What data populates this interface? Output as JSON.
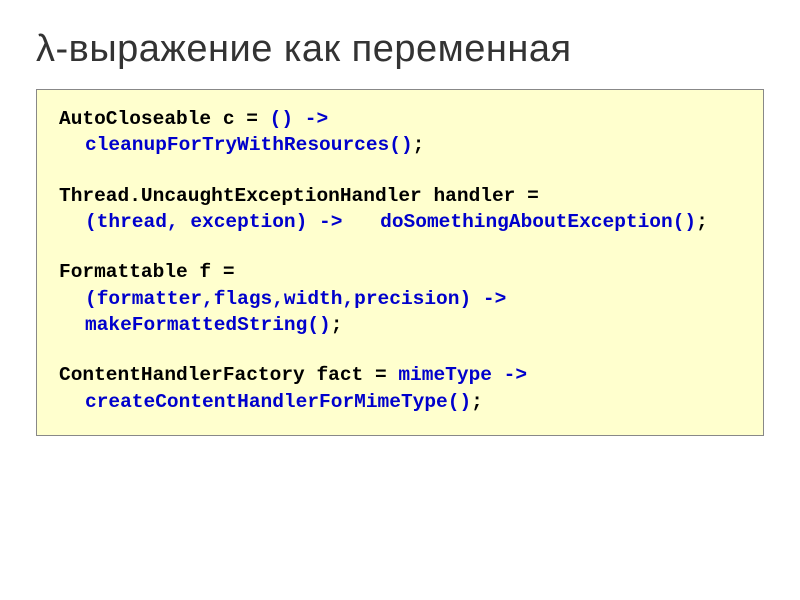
{
  "title": "λ-выражение как переменная",
  "code": {
    "s1": {
      "l1a": "AutoCloseable c = ",
      "l1b": "() ->",
      "l2a": "cleanupForTryWithResources()",
      "l2b": ";"
    },
    "s2": {
      "l1": "Thread.UncaughtExceptionHandler handler =",
      "l2": "(thread, exception) ->",
      "l3a": "doSomethingAboutException()",
      "l3b": ";"
    },
    "s3": {
      "l1": "Formattable f =",
      "l2": "(formatter,flags,width,precision) ->",
      "l3a": "makeFormattedString()",
      "l3b": ";"
    },
    "s4": {
      "l1a": "ContentHandlerFactory fact = ",
      "l1b": "mimeType ->",
      "l2a": "createContentHandlerForMimeType()",
      "l2b": ";"
    }
  }
}
